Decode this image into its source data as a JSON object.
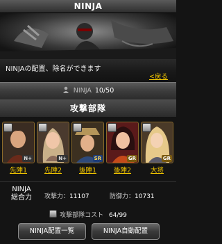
{
  "title": "NINJA",
  "info": {
    "message": "NINJAの配置、除名ができます",
    "back": "<戻る"
  },
  "count": {
    "label": "NINJA",
    "value": "10/50"
  },
  "section_title": "攻撃部隊",
  "cards": [
    {
      "label": "先陣1",
      "rarity": "N+"
    },
    {
      "label": "先陣2",
      "rarity": "N+"
    },
    {
      "label": "後陣1",
      "rarity": "SR"
    },
    {
      "label": "後陣2",
      "rarity": "GR"
    },
    {
      "label": "大将",
      "rarity": "GR"
    }
  ],
  "stats": {
    "title_line1": "NINJA",
    "title_line2": "総合力",
    "attack_label": "攻撃力：",
    "attack_value": "11107",
    "defense_label": "防御力：",
    "defense_value": "10731"
  },
  "cost": {
    "label": "攻撃部隊コスト",
    "value": "64/99"
  },
  "buttons": {
    "list": "NINJA配置一覧",
    "auto": "NINJA自動配置"
  },
  "colors": {
    "link": "#f1c500",
    "frame": "#8a6a2a"
  }
}
